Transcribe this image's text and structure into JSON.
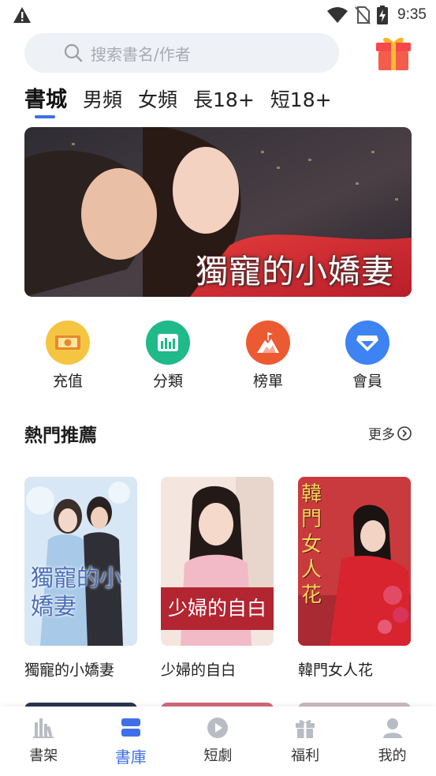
{
  "status_bar": {
    "time": "9:35",
    "icons": [
      "warning-icon",
      "wifi-icon",
      "no-sim-icon",
      "battery-charging-icon"
    ]
  },
  "search": {
    "placeholder": "搜索書名/作者",
    "icon": "search-icon"
  },
  "gift_icon": "gift-icon",
  "tabs": [
    {
      "label": "書城",
      "active": true
    },
    {
      "label": "男頻",
      "active": false
    },
    {
      "label": "女頻",
      "active": false
    },
    {
      "label": "長18+",
      "active": false
    },
    {
      "label": "短18+",
      "active": false
    }
  ],
  "banner": {
    "title": "獨寵的小嬌妻"
  },
  "quick_actions": [
    {
      "label": "充值",
      "icon": "cash-icon",
      "color": "#f5c542"
    },
    {
      "label": "分類",
      "icon": "bar-chart-icon",
      "color": "#20b98a"
    },
    {
      "label": "榜單",
      "icon": "mountain-flag-icon",
      "color": "#ec5a32"
    },
    {
      "label": "會員",
      "icon": "diamond-icon",
      "color": "#3d83f2"
    }
  ],
  "section": {
    "title": "熱門推薦",
    "more_label": "更多"
  },
  "books": [
    {
      "title": "獨寵的小嬌妻",
      "cover_text": "獨寵的小嬌妻"
    },
    {
      "title": "少婦的自白",
      "cover_text": "少婦的自白"
    },
    {
      "title": "韓門女人花",
      "cover_text": "韓門女人花"
    }
  ],
  "bottom_nav": [
    {
      "label": "書架",
      "icon": "bookshelf-icon",
      "active": false
    },
    {
      "label": "書庫",
      "icon": "library-icon",
      "active": true
    },
    {
      "label": "短劇",
      "icon": "play-icon",
      "active": false
    },
    {
      "label": "福利",
      "icon": "gift-icon",
      "active": false
    },
    {
      "label": "我的",
      "icon": "user-icon",
      "active": false
    }
  ],
  "colors": {
    "accent": "#3f6fe8",
    "search_bg": "#eef1f5"
  }
}
